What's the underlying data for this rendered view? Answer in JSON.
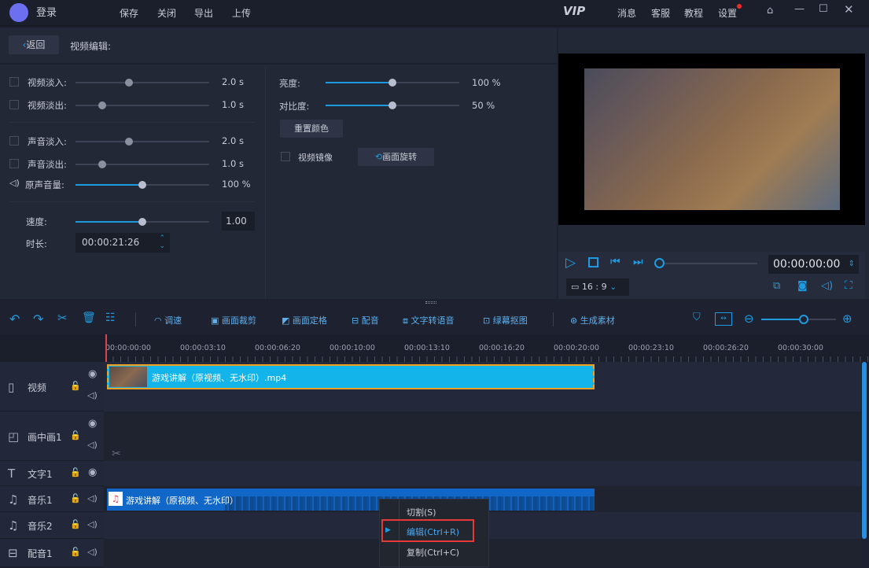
{
  "topbar": {
    "login": "登录",
    "menu": [
      "保存",
      "关闭",
      "导出",
      "上传"
    ],
    "vip": "VIP",
    "right": [
      "消息",
      "客服",
      "教程",
      "设置"
    ]
  },
  "editor": {
    "back": "返回",
    "title": "视频编辑:",
    "left": [
      {
        "label": "视频淡入:",
        "value": "2.0 s",
        "pos": 0.4
      },
      {
        "label": "视频淡出:",
        "value": "1.0 s",
        "pos": 0.2
      },
      {
        "label": "声音淡入:",
        "value": "2.0 s",
        "pos": 0.4
      },
      {
        "label": "声音淡出:",
        "value": "1.0 s",
        "pos": 0.2
      },
      {
        "label": "原声音量:",
        "value": "100 %",
        "pos": 0.5
      }
    ],
    "speed_label": "速度:",
    "speed_value": "1.00",
    "speed_pos": 0.5,
    "duration_label": "时长:",
    "duration_value": "00:00:21:26",
    "brightness_label": "亮度:",
    "brightness_value": "100 %",
    "brightness_pos": 0.5,
    "contrast_label": "对比度:",
    "contrast_value": "50 %",
    "contrast_pos": 0.5,
    "reset_color": "重置颜色",
    "mirror": "视频镜像",
    "rotate": "画面旋转"
  },
  "preview": {
    "time": "00:00:00:00",
    "ratio": "16 : 9"
  },
  "toolbar": {
    "items": [
      "调速",
      "画面裁剪",
      "画面定格",
      "配音",
      "文字转语音",
      "绿幕抠图",
      "生成素材"
    ]
  },
  "ruler": [
    "00:00:00:00",
    "00:00:03:10",
    "00:00:06:20",
    "00:00:10:00",
    "00:00:13:10",
    "00:00:16:20",
    "00:00:20:00",
    "00:00:23:10",
    "00:00:26:20",
    "00:00:30:00"
  ],
  "tracks": [
    {
      "name": "视频"
    },
    {
      "name": "画中画1"
    },
    {
      "name": "文字1"
    },
    {
      "name": "音乐1"
    },
    {
      "name": "音乐2"
    },
    {
      "name": "配音1"
    }
  ],
  "clips": {
    "video": "游戏讲解（原视频、无水印）.mp4",
    "audio": "游戏讲解（原视频、无水印）"
  },
  "context_menu": [
    "切割(S)",
    "编辑(Ctrl+R)",
    "复制(Ctrl+C)"
  ],
  "colors": {
    "accent": "#1e9be0",
    "clip_video": "#12b4ea",
    "clip_audio": "#1167c8",
    "highlight": "#e53935"
  }
}
